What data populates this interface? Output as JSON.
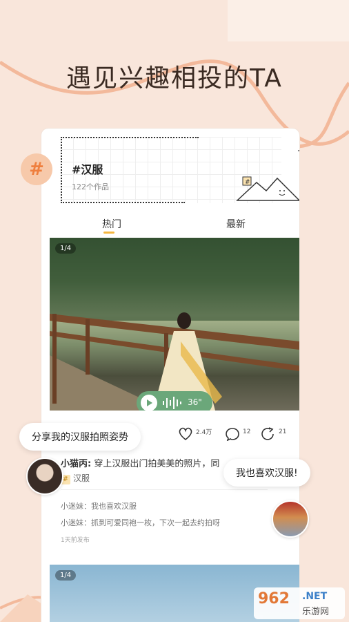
{
  "headline": "遇见兴趣相投的TA",
  "hash_badge": "#",
  "topic": {
    "title": "#汉服",
    "count": "122个作品"
  },
  "tabs": [
    {
      "label": "热门"
    },
    {
      "label": "最新"
    }
  ],
  "post": {
    "page_badge": "1/4",
    "audio_duration": "36\"",
    "likes": "2.4万",
    "comments_count": "12",
    "shares": "21",
    "author": "小猫丙:",
    "text": " 穿上汉服出门拍美美的照片，同",
    "tag_symbol": "#",
    "tag": "汉服",
    "comments": [
      {
        "text": "小迷妹：我也喜欢汉服"
      },
      {
        "text": "小迷妹：抓到可爱同袍一枚，下次一起去约拍呀"
      }
    ],
    "time": "1天前发布"
  },
  "post2": {
    "page_badge": "1/4"
  },
  "bubbles": {
    "left": "分享我的汉服拍照姿势",
    "right": "我也喜欢汉服!"
  },
  "watermark": {
    "num": "962",
    "net": ".NET",
    "cn": "乐游网"
  },
  "colors": {
    "background": "#f9e6db",
    "accent_orange": "#ef7f3e",
    "audio_green": "#6ba77a",
    "tab_underline": "#f4b740"
  }
}
